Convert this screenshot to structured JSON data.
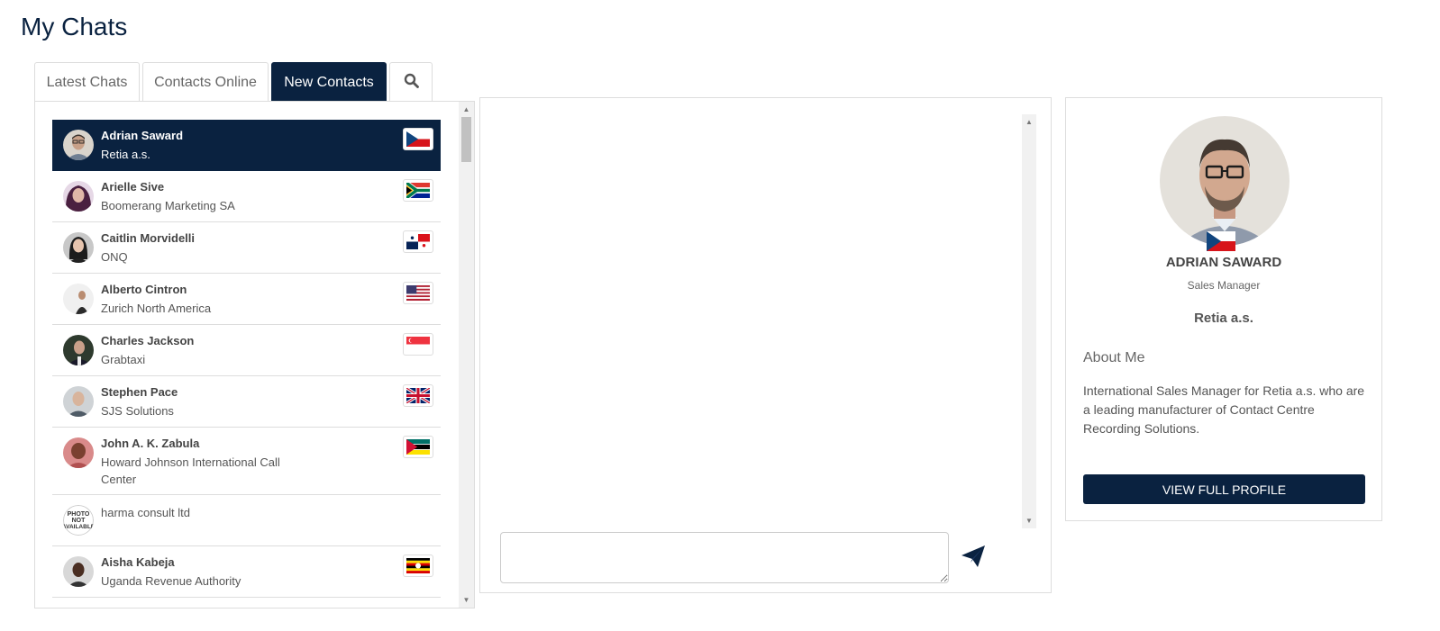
{
  "page": {
    "title": "My Chats"
  },
  "tabs": [
    {
      "label": "Latest Chats"
    },
    {
      "label": "Contacts Online"
    },
    {
      "label": "New Contacts"
    },
    {
      "icon": "search-icon"
    }
  ],
  "contacts": [
    {
      "name": "Adrian Saward",
      "company": "Retia a.s.",
      "flag": "cz",
      "selected": true
    },
    {
      "name": "Arielle Sive",
      "company": "Boomerang Marketing SA",
      "flag": "za"
    },
    {
      "name": "Caitlin Morvidelli",
      "company": "ONQ",
      "flag": "pa"
    },
    {
      "name": "Alberto Cintron",
      "company": "Zurich North America",
      "flag": "us"
    },
    {
      "name": "Charles Jackson",
      "company": "Grabtaxi",
      "flag": "sg"
    },
    {
      "name": "Stephen Pace",
      "company": "SJS Solutions",
      "flag": "gb"
    },
    {
      "name": "John A. K. Zabula",
      "company": "Howard Johnson International Call Center",
      "flag": "mz"
    },
    {
      "name": "",
      "company": "harma consult ltd",
      "flag": "",
      "avatar_text": "PHOTO NOT AVAILABLE"
    },
    {
      "name": "Aisha Kabeja",
      "company": "Uganda Revenue Authority",
      "flag": "ug"
    }
  ],
  "chat": {
    "input_value": "",
    "send_icon": "paper-plane-icon"
  },
  "profile": {
    "name": "ADRIAN SAWARD",
    "role": "Sales Manager",
    "company": "Retia a.s.",
    "flag": "cz",
    "about_heading": "About Me",
    "about_text": "International Sales Manager for Retia a.s. who are a leading manufacturer of Contact Centre Recording Solutions.",
    "button_label": "VIEW FULL PROFILE"
  },
  "colors": {
    "navy": "#0a2240",
    "border": "#dddddd"
  }
}
